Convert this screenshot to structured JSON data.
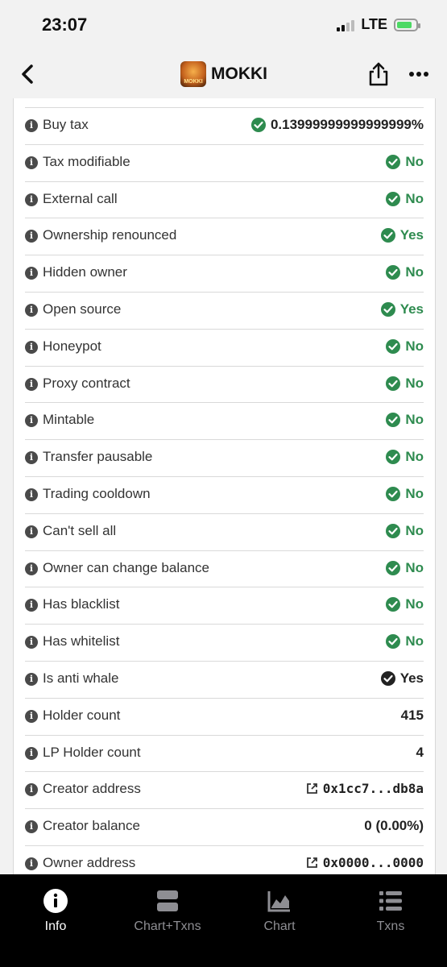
{
  "status_bar": {
    "time": "23:07",
    "network": "LTE"
  },
  "header": {
    "title": "MOKKI",
    "logo_text": "MOKKI"
  },
  "rows": [
    {
      "label": "Buy tax",
      "value": "0.13999999999999999%",
      "status": "green"
    },
    {
      "label": "Tax modifiable",
      "value": "No",
      "status": "green"
    },
    {
      "label": "External call",
      "value": "No",
      "status": "green"
    },
    {
      "label": "Ownership renounced",
      "value": "Yes",
      "status": "green"
    },
    {
      "label": "Hidden owner",
      "value": "No",
      "status": "green"
    },
    {
      "label": "Open source",
      "value": "Yes",
      "status": "green"
    },
    {
      "label": "Honeypot",
      "value": "No",
      "status": "green"
    },
    {
      "label": "Proxy contract",
      "value": "No",
      "status": "green"
    },
    {
      "label": "Mintable",
      "value": "No",
      "status": "green"
    },
    {
      "label": "Transfer pausable",
      "value": "No",
      "status": "green"
    },
    {
      "label": "Trading cooldown",
      "value": "No",
      "status": "green"
    },
    {
      "label": "Can't sell all",
      "value": "No",
      "status": "green"
    },
    {
      "label": "Owner can change balance",
      "value": "No",
      "status": "green"
    },
    {
      "label": "Has blacklist",
      "value": "No",
      "status": "green"
    },
    {
      "label": "Has whitelist",
      "value": "No",
      "status": "green"
    },
    {
      "label": "Is anti whale",
      "value": "Yes",
      "status": "dark"
    },
    {
      "label": "Holder count",
      "value": "415",
      "status": "plain"
    },
    {
      "label": "LP Holder count",
      "value": "4",
      "status": "plain"
    },
    {
      "label": "Creator address",
      "value": "0x1cc7...db8a",
      "status": "link"
    },
    {
      "label": "Creator balance",
      "value": "0 (0.00%)",
      "status": "plain"
    },
    {
      "label": "Owner address",
      "value": "0x0000...0000",
      "status": "link"
    }
  ],
  "tabs": [
    {
      "label": "Info",
      "icon": "info-icon",
      "active": true
    },
    {
      "label": "Chart+Txns",
      "icon": "split-view-icon",
      "active": false
    },
    {
      "label": "Chart",
      "icon": "area-chart-icon",
      "active": false
    },
    {
      "label": "Txns",
      "icon": "list-icon",
      "active": false
    }
  ],
  "colors": {
    "green": "#2e8b4f",
    "dark": "#222222",
    "tab_bar": "#000000"
  }
}
